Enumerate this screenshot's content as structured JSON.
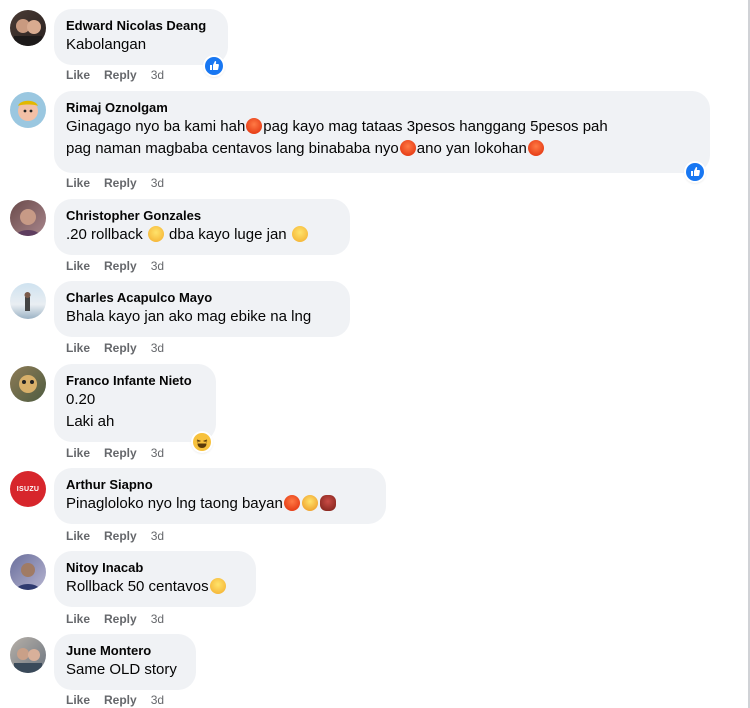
{
  "action_labels": {
    "like": "Like",
    "reply": "Reply"
  },
  "comments": [
    {
      "author": "Edward Nicolas Deang",
      "lines": [
        "Kabolangan"
      ],
      "time": "3d",
      "reaction": "like-icon"
    },
    {
      "author": "Rimaj Oznolgam",
      "lines": [
        "Ginagago nyo ba kami hah",
        "pag kayo mag tataas 3pesos hanggang 5pesos pah",
        "pag naman magbaba centavos lang binababa nyo",
        "ano yan lokohan"
      ],
      "time": "3d",
      "reaction": "like-icon"
    },
    {
      "author": "Christopher Gonzales",
      "lines": [
        ".20 rollback ",
        " dba kayo luge jan "
      ],
      "time": "3d"
    },
    {
      "author": "Charles Acapulco Mayo",
      "lines": [
        "Bhala kayo jan ako mag ebike na lng"
      ],
      "time": "3d"
    },
    {
      "author": "Franco Infante Nieto",
      "lines": [
        "0.20",
        "Laki ah"
      ],
      "time": "3d",
      "reaction": "haha-icon"
    },
    {
      "author": "Arthur Siapno",
      "lines": [
        "Pinagloloko nyo lng taong bayan"
      ],
      "time": "3d",
      "avatar_text": "ISUZU"
    },
    {
      "author": "Nitoy Inacab",
      "lines": [
        "Rollback 50 centavos"
      ],
      "time": "3d"
    },
    {
      "author": "June Montero",
      "lines": [
        "Same OLD story"
      ],
      "time": "3d"
    }
  ],
  "colors": {
    "bubble": "#f0f2f5",
    "meta": "#65676b",
    "like_blue": "#1877f2"
  }
}
